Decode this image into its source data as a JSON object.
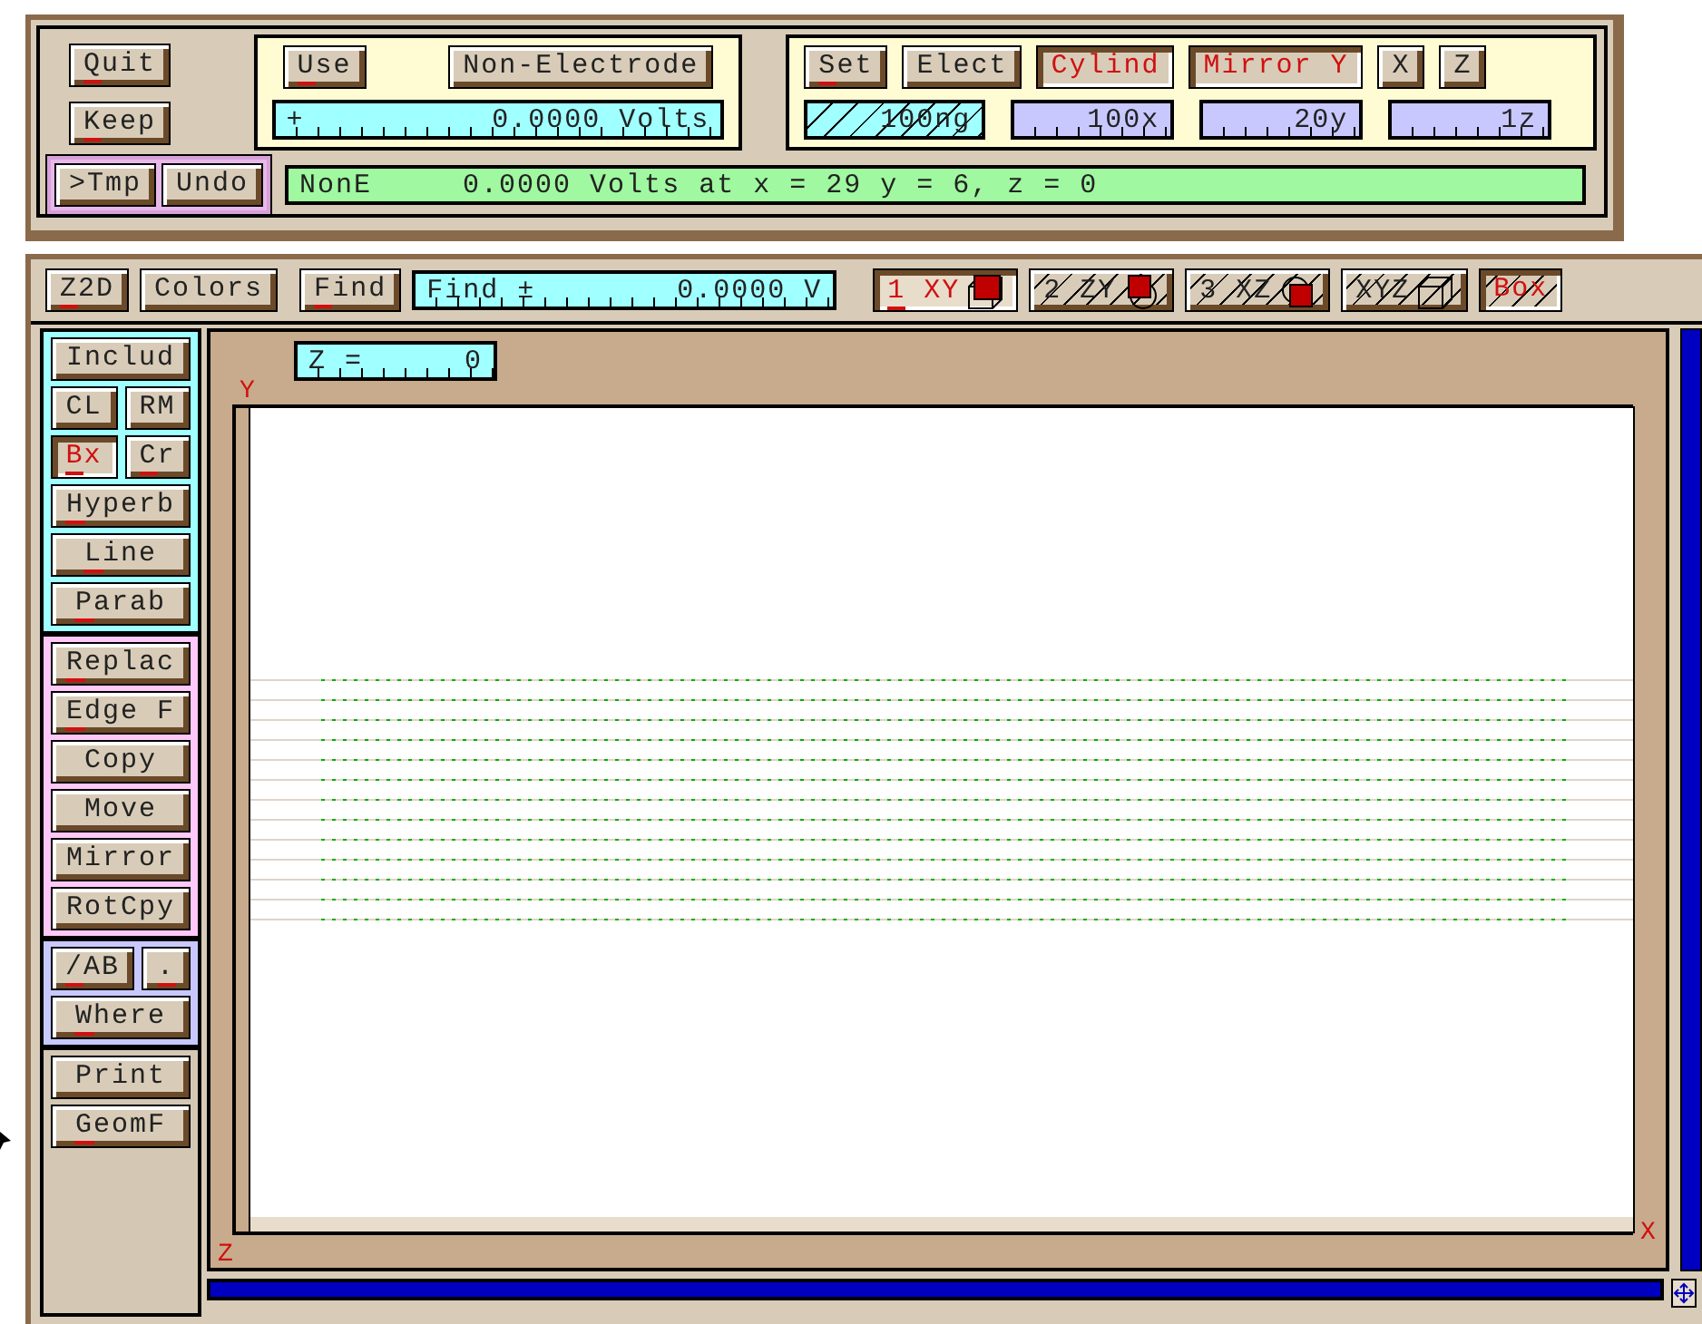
{
  "top_panel": {
    "main_buttons": [
      {
        "label": "Quit",
        "hotkey": true,
        "active": false,
        "disabled": false
      },
      {
        "label": "Keep",
        "hotkey": true,
        "active": false,
        "disabled": false
      }
    ],
    "electrode_group": {
      "buttons": [
        {
          "label": "Use",
          "hotkey": true,
          "active": false,
          "disabled": false
        },
        {
          "label": "Non-Electrode",
          "hotkey": false,
          "active": false,
          "disabled": false
        }
      ],
      "voltage_field": {
        "sign": "+",
        "value": "0.0000 Volts"
      }
    },
    "symmetry_group": {
      "buttons": [
        {
          "label": "Set",
          "hotkey": true,
          "active": false,
          "disabled": false
        },
        {
          "label": "Elect",
          "hotkey": false,
          "active": false,
          "disabled": false
        },
        {
          "label": "Cylind",
          "hotkey": false,
          "active": true,
          "disabled": false
        },
        {
          "label": "Mirror Y",
          "hotkey": false,
          "active": true,
          "disabled": false
        },
        {
          "label": "X",
          "hotkey": false,
          "active": false,
          "disabled": false
        },
        {
          "label": "Z",
          "hotkey": false,
          "active": false,
          "disabled": false
        }
      ],
      "fields": [
        {
          "value": "100ng",
          "kind": "hatched"
        },
        {
          "value": "100x",
          "kind": "plain"
        },
        {
          "value": "20y",
          "kind": "plain"
        },
        {
          "value": "1z",
          "kind": "plain"
        }
      ]
    },
    "undo_group": {
      "buttons": [
        {
          "label": ">Tmp",
          "hotkey": false,
          "active": false,
          "disabled": false
        },
        {
          "label": "Undo",
          "hotkey": false,
          "active": false,
          "disabled": false
        }
      ]
    },
    "status_bar": {
      "name": "NonE",
      "text": "0.0000 Volts at x = 29 y = 6, z = 0"
    }
  },
  "toolbar": {
    "buttons": [
      {
        "label": "Z2D",
        "hotkey": true,
        "active": false,
        "disabled": false
      },
      {
        "label": "Colors",
        "hotkey": false,
        "active": false,
        "disabled": false
      }
    ],
    "find_button": {
      "label": "Find",
      "hotkey": true,
      "active": false,
      "disabled": false
    },
    "find_field": {
      "label": "Find ±",
      "value": "0.0000 V"
    },
    "view_tabs": [
      {
        "label": "1 XY",
        "hotkey": true,
        "selected": true,
        "active": true,
        "disabled": false
      },
      {
        "label": "2 ZY",
        "hotkey": false,
        "selected": false,
        "active": false,
        "disabled": true
      },
      {
        "label": "3 XZ",
        "hotkey": false,
        "selected": false,
        "active": false,
        "disabled": true
      },
      {
        "label": "XYZ",
        "hotkey": false,
        "selected": false,
        "active": false,
        "disabled": true
      },
      {
        "label": "Box",
        "hotkey": false,
        "selected": false,
        "active": true,
        "disabled": true
      }
    ]
  },
  "sidebar": {
    "groups": [
      {
        "color": "#a0ffff",
        "rows": [
          [
            {
              "label": "Includ",
              "hotkey": false,
              "active": false,
              "disabled": false
            }
          ],
          [
            {
              "label": "CL",
              "hotkey": false,
              "active": false,
              "disabled": false
            },
            {
              "label": "RM",
              "hotkey": false,
              "active": false,
              "disabled": false
            }
          ],
          [
            {
              "label": "Bx",
              "hotkey": true,
              "active": true,
              "disabled": false
            },
            {
              "label": "Cr",
              "hotkey": true,
              "active": false,
              "disabled": false
            }
          ],
          [
            {
              "label": "Hyperb",
              "hotkey": true,
              "active": false,
              "disabled": false
            }
          ],
          [
            {
              "label": "Line",
              "hotkey": true,
              "active": false,
              "disabled": false
            }
          ],
          [
            {
              "label": "Parab",
              "hotkey": true,
              "active": false,
              "disabled": false
            }
          ]
        ]
      },
      {
        "color": "#ffc8f8",
        "rows": [
          [
            {
              "label": "Replac",
              "hotkey": true,
              "active": false,
              "disabled": false
            }
          ],
          [
            {
              "label": "Edge F",
              "hotkey": true,
              "active": false,
              "disabled": false
            }
          ],
          [
            {
              "label": "Copy",
              "hotkey": false,
              "active": false,
              "disabled": false
            }
          ],
          [
            {
              "label": "Move",
              "hotkey": false,
              "active": false,
              "disabled": false
            }
          ],
          [
            {
              "label": "Mirror",
              "hotkey": false,
              "active": false,
              "disabled": false
            }
          ],
          [
            {
              "label": "RotCpy",
              "hotkey": false,
              "active": false,
              "disabled": false
            }
          ]
        ]
      },
      {
        "color": "#c8c8ff",
        "rows": [
          [
            {
              "label": "/AB",
              "hotkey": true,
              "active": false,
              "disabled": false
            },
            {
              "label": ".",
              "hotkey": true,
              "active": false,
              "disabled": false
            }
          ],
          [
            {
              "label": "Where",
              "hotkey": true,
              "active": false,
              "disabled": false
            }
          ]
        ]
      },
      {
        "color": "#d4c8b4",
        "rows": [
          [
            {
              "label": "Print",
              "hotkey": false,
              "active": false,
              "disabled": false
            }
          ],
          [
            {
              "label": "GeomF",
              "hotkey": true,
              "active": false,
              "disabled": false
            }
          ]
        ]
      }
    ]
  },
  "canvas": {
    "z_field": {
      "label": "Z =",
      "value": "0"
    },
    "axes": {
      "y": "Y",
      "z": "Z",
      "x": "X"
    }
  }
}
